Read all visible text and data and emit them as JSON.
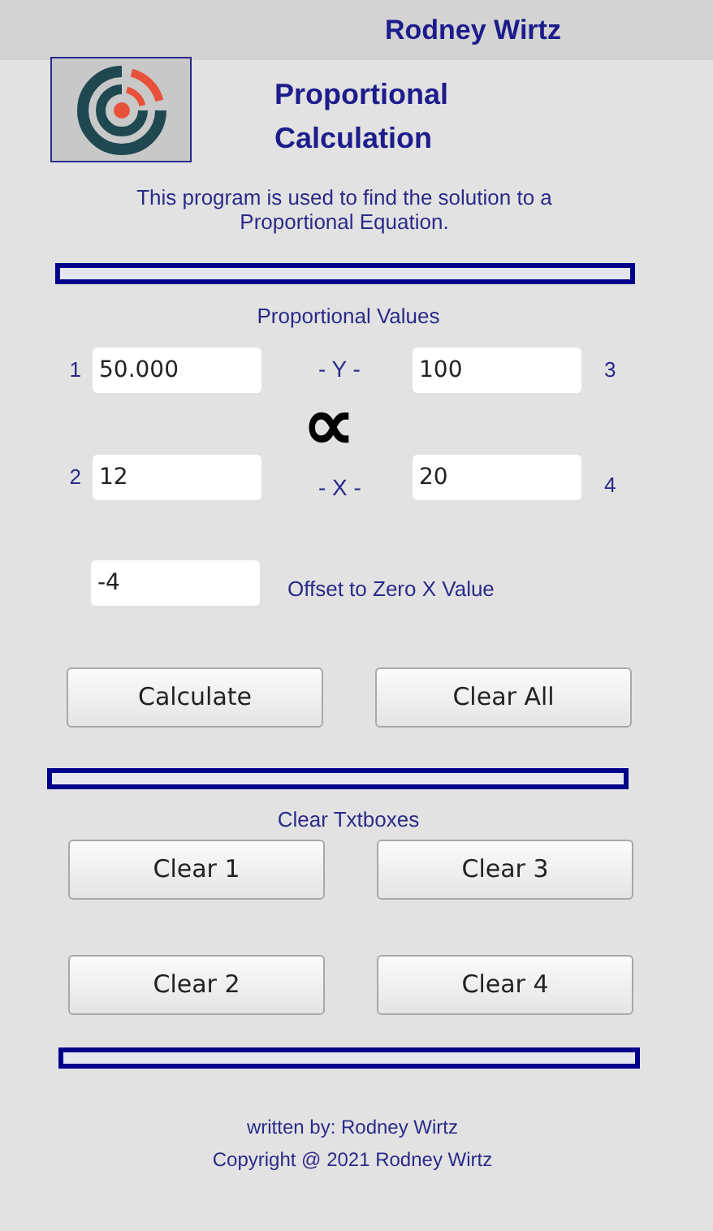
{
  "header": {
    "title": "Rodney Wirtz"
  },
  "app_title": "Proportional Calculation",
  "description": "This program is used to find the solution to a Proportional Equation.",
  "values_section": {
    "label": "Proportional Values",
    "y_label": "- Y -",
    "x_label": "- X -",
    "symbol": "∝",
    "fields": [
      {
        "index": "1",
        "value": "50.000"
      },
      {
        "index": "2",
        "value": "12"
      },
      {
        "index": "3",
        "value": "100"
      },
      {
        "index": "4",
        "value": "20"
      }
    ],
    "offset": {
      "value": "-4",
      "label": "Offset to Zero X Value"
    }
  },
  "buttons": [
    "Calculate",
    "Clear All"
  ],
  "clear_section": {
    "label": "Clear Txtboxes",
    "buttons": [
      "Clear 1",
      "Clear 3",
      "Clear 2",
      "Clear 4"
    ]
  },
  "footer": [
    "written by: Rodney Wirtz",
    "Copyright @ 2021 Rodney Wirtz"
  ]
}
